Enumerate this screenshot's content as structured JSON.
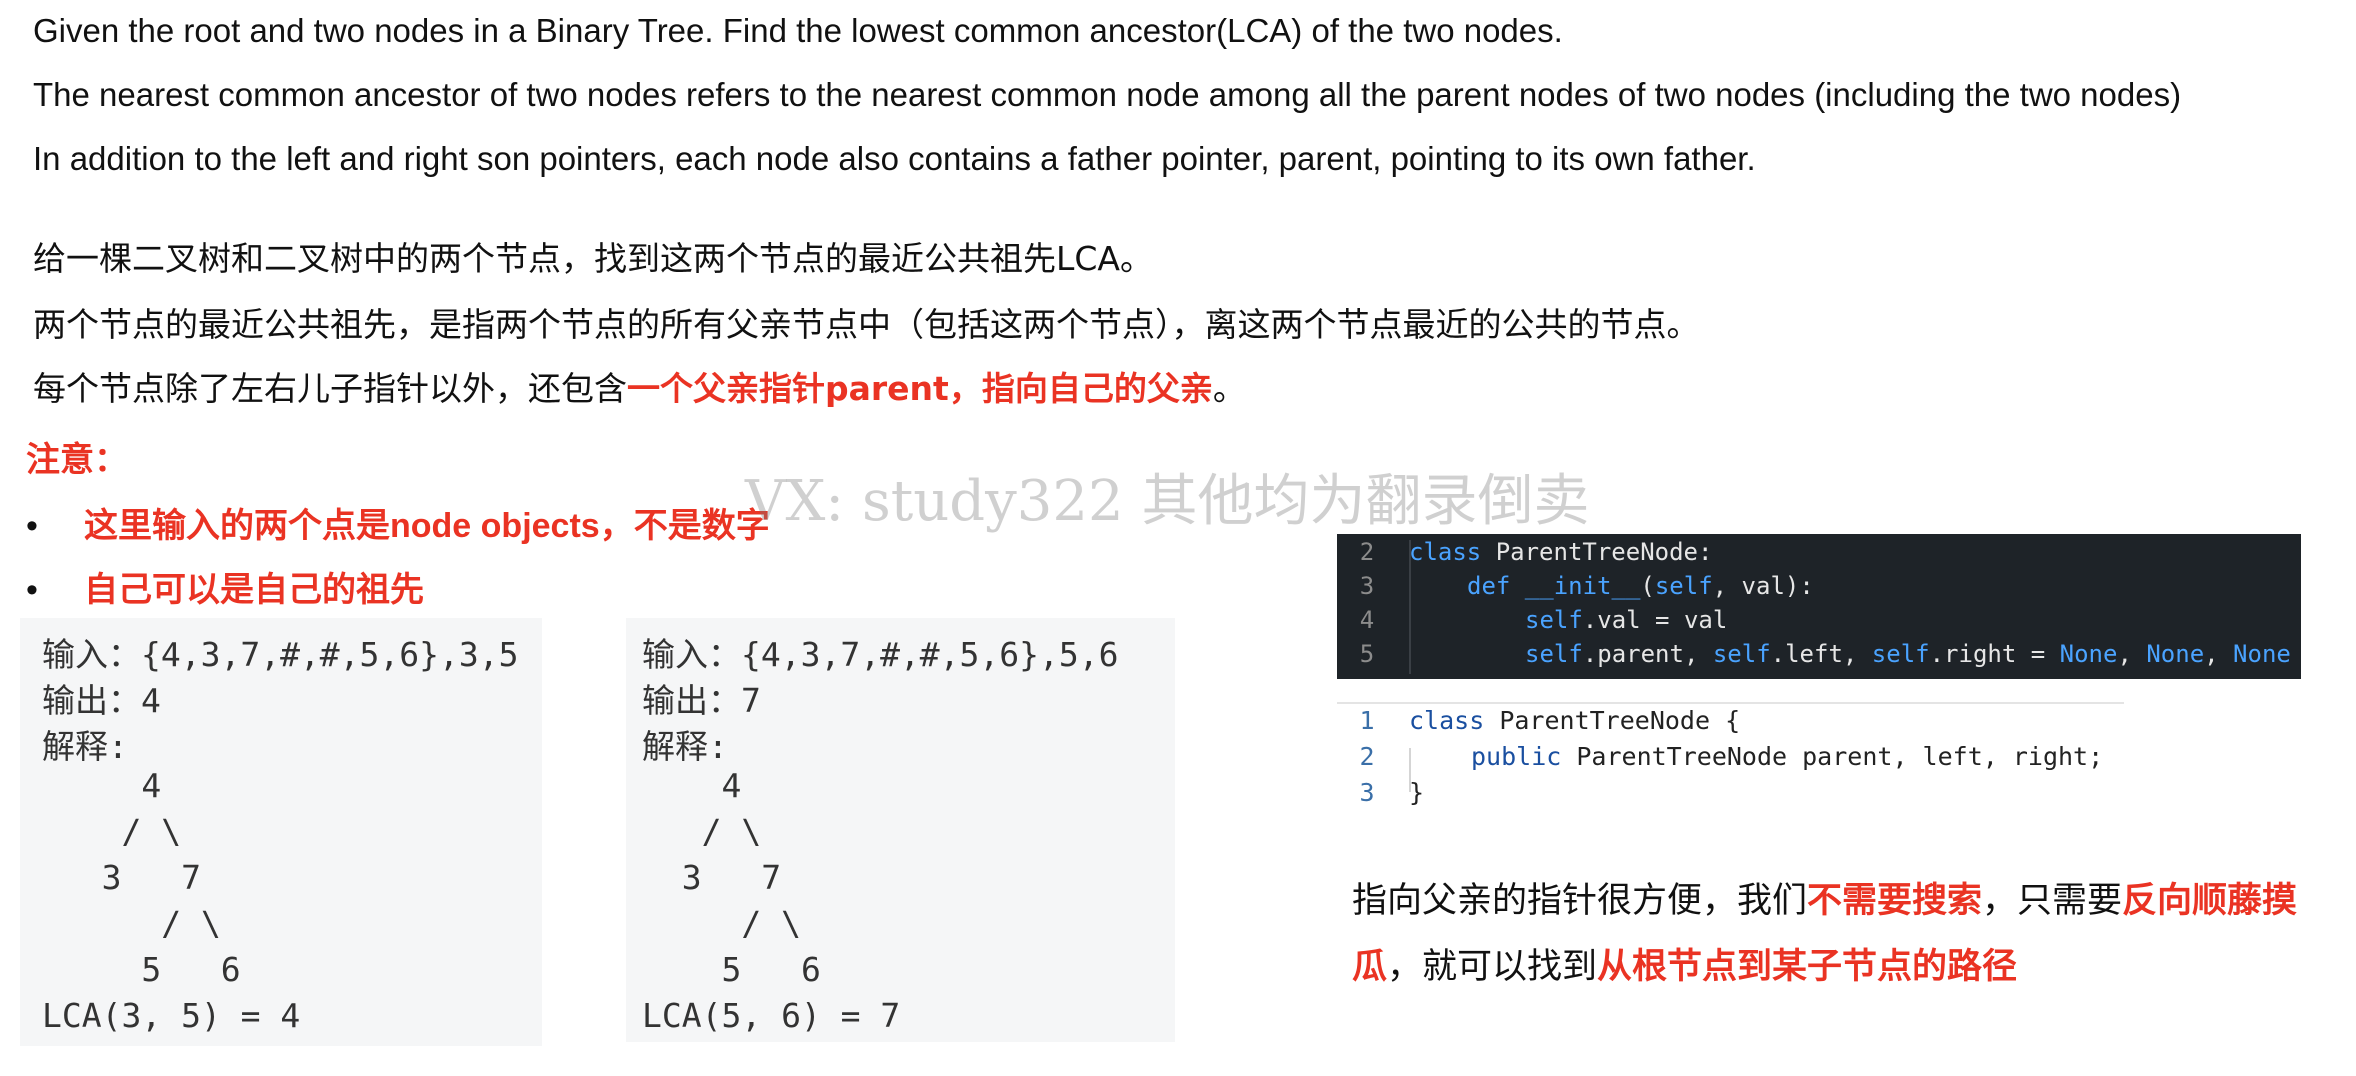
{
  "english": {
    "line1": "Given the root and two nodes in a Binary Tree. Find the lowest common ancestor(LCA) of the two nodes.",
    "line2": "The nearest common ancestor of two nodes refers to the nearest common node among all the parent nodes of two nodes (including the two nodes)",
    "line3": "In addition to the left and right son pointers, each node also contains a father pointer, parent, pointing to its own father."
  },
  "chinese": {
    "line1": "给一棵二叉树和二叉树中的两个节点，找到这两个节点的最近公共祖先LCA。",
    "line2": "两个节点的最近公共祖先，是指两个节点的所有父亲节点中（包括这两个节点），离这两个节点最近的公共的节点。",
    "line3_prefix": "每个节点除了左右儿子指针以外，还包含",
    "line3_highlight": "一个父亲指针parent，指向自己的父亲",
    "line3_suffix": "。"
  },
  "note": {
    "title": "注意：",
    "bullet_char": "•",
    "items": [
      "这里输入的两个点是node objects，不是数字",
      "自己可以是自己的祖先"
    ]
  },
  "watermark": "VX: study322 其他均为翻录倒卖",
  "examples": [
    {
      "lines": [
        "输入：{4,3,7,#,#,5,6},3,5",
        "输出：4",
        "解释:",
        "     4",
        "    / \\",
        "   3   7",
        "      / \\",
        "     5   6",
        "LCA(3, 5) = 4"
      ]
    },
    {
      "lines": [
        "输入：{4,3,7,#,#,5,6},5,6",
        "输出：7",
        "解释:",
        "    4",
        "   / \\",
        "  3   7",
        "     / \\",
        "    5   6",
        "LCA(5, 6) = 7"
      ]
    }
  ],
  "python_code": {
    "line_numbers": [
      "2",
      "3",
      "4",
      "5"
    ],
    "l2_kw": "class",
    "l2_rest": " ParentTreeNode:",
    "l3_kw": "def",
    "l3_fn": " __init__",
    "l3_open": "(",
    "l3_self": "self",
    "l3_rest": ", val):",
    "l4_self": "self",
    "l4_rest": ".val = val",
    "l5_self1": "self",
    "l5_a": ".parent, ",
    "l5_self2": "self",
    "l5_b": ".left, ",
    "l5_self3": "self",
    "l5_c": ".right = ",
    "l5_none1": "None",
    "l5_sep1": ", ",
    "l5_none2": "None",
    "l5_sep2": ", ",
    "l5_none3": "None"
  },
  "java_code": {
    "line_numbers": [
      "1",
      "2",
      "3"
    ],
    "l1_kw": "class",
    "l1_rest": " ParentTreeNode {",
    "l2_kw": "public",
    "l2_rest": " ParentTreeNode parent, left, right;",
    "l3": "}"
  },
  "summary": {
    "p1": "指向父亲的指针很方便，我们",
    "h1": "不需要搜索",
    "p2": "，只需要",
    "h2": "反向顺藤摸",
    "h3": "瓜",
    "p3": "，就可以找到",
    "h4": "从根节点到某子节点的路径"
  },
  "colors": {
    "highlight": "#ea3323",
    "code_bg": "#1e2328",
    "example_bg": "#f5f6f7"
  }
}
